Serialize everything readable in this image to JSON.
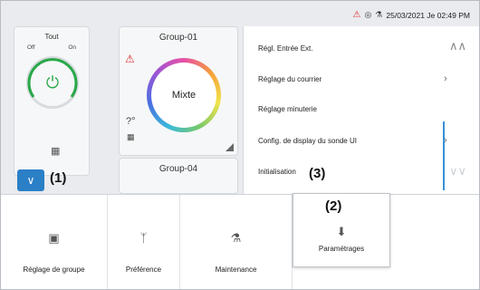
{
  "status": {
    "datetime": "25/03/2021 Je 02:49 PM",
    "icons": [
      "warning-icon",
      "network-icon",
      "maintenance-icon"
    ]
  },
  "all_panel": {
    "title": "Tout",
    "off_label": "Off",
    "on_label": "On"
  },
  "groups": [
    {
      "name": "Group-01",
      "mode": "Mixte"
    },
    {
      "name": "Group-04"
    }
  ],
  "callouts": {
    "c1": "(1)",
    "c2": "(2)",
    "c3": "(3)"
  },
  "menu": {
    "items": [
      {
        "label": "Régl. Entrée Ext.",
        "has_chevron": false
      },
      {
        "label": "Réglage du courrier",
        "has_chevron": true
      },
      {
        "label": "Réglage minuterie",
        "has_chevron": false
      },
      {
        "label": "Config. de display du sonde UI",
        "has_chevron": true
      },
      {
        "label": "Initialisation",
        "has_chevron": false
      }
    ]
  },
  "bottom_bar": {
    "buttons": [
      {
        "label": "Réglage de groupe",
        "icon": "group-settings-icon"
      },
      {
        "label": "Préférence",
        "icon": "preference-icon"
      },
      {
        "label": "Maintenance",
        "icon": "maintenance-icon"
      },
      {
        "label": "Paramétrages",
        "icon": "settings-download-icon"
      }
    ]
  },
  "colors": {
    "accent": "#2b7fc6",
    "alert": "#e3262c",
    "power_on": "#2aa84a"
  }
}
